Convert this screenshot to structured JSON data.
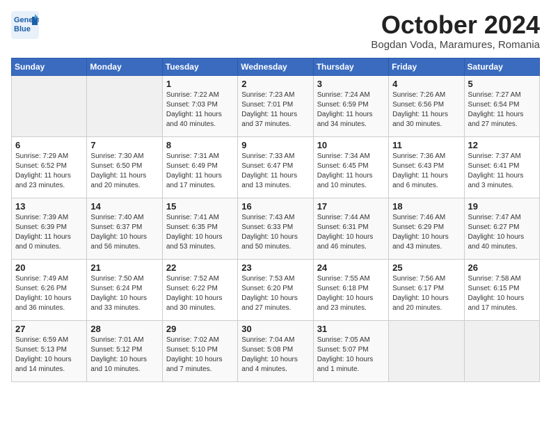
{
  "header": {
    "logo_line1": "General",
    "logo_line2": "Blue",
    "month": "October 2024",
    "location": "Bogdan Voda, Maramures, Romania"
  },
  "days_of_week": [
    "Sunday",
    "Monday",
    "Tuesday",
    "Wednesday",
    "Thursday",
    "Friday",
    "Saturday"
  ],
  "weeks": [
    [
      {
        "day": "",
        "info": ""
      },
      {
        "day": "",
        "info": ""
      },
      {
        "day": "1",
        "info": "Sunrise: 7:22 AM\nSunset: 7:03 PM\nDaylight: 11 hours and 40 minutes."
      },
      {
        "day": "2",
        "info": "Sunrise: 7:23 AM\nSunset: 7:01 PM\nDaylight: 11 hours and 37 minutes."
      },
      {
        "day": "3",
        "info": "Sunrise: 7:24 AM\nSunset: 6:59 PM\nDaylight: 11 hours and 34 minutes."
      },
      {
        "day": "4",
        "info": "Sunrise: 7:26 AM\nSunset: 6:56 PM\nDaylight: 11 hours and 30 minutes."
      },
      {
        "day": "5",
        "info": "Sunrise: 7:27 AM\nSunset: 6:54 PM\nDaylight: 11 hours and 27 minutes."
      }
    ],
    [
      {
        "day": "6",
        "info": "Sunrise: 7:29 AM\nSunset: 6:52 PM\nDaylight: 11 hours and 23 minutes."
      },
      {
        "day": "7",
        "info": "Sunrise: 7:30 AM\nSunset: 6:50 PM\nDaylight: 11 hours and 20 minutes."
      },
      {
        "day": "8",
        "info": "Sunrise: 7:31 AM\nSunset: 6:49 PM\nDaylight: 11 hours and 17 minutes."
      },
      {
        "day": "9",
        "info": "Sunrise: 7:33 AM\nSunset: 6:47 PM\nDaylight: 11 hours and 13 minutes."
      },
      {
        "day": "10",
        "info": "Sunrise: 7:34 AM\nSunset: 6:45 PM\nDaylight: 11 hours and 10 minutes."
      },
      {
        "day": "11",
        "info": "Sunrise: 7:36 AM\nSunset: 6:43 PM\nDaylight: 11 hours and 6 minutes."
      },
      {
        "day": "12",
        "info": "Sunrise: 7:37 AM\nSunset: 6:41 PM\nDaylight: 11 hours and 3 minutes."
      }
    ],
    [
      {
        "day": "13",
        "info": "Sunrise: 7:39 AM\nSunset: 6:39 PM\nDaylight: 11 hours and 0 minutes."
      },
      {
        "day": "14",
        "info": "Sunrise: 7:40 AM\nSunset: 6:37 PM\nDaylight: 10 hours and 56 minutes."
      },
      {
        "day": "15",
        "info": "Sunrise: 7:41 AM\nSunset: 6:35 PM\nDaylight: 10 hours and 53 minutes."
      },
      {
        "day": "16",
        "info": "Sunrise: 7:43 AM\nSunset: 6:33 PM\nDaylight: 10 hours and 50 minutes."
      },
      {
        "day": "17",
        "info": "Sunrise: 7:44 AM\nSunset: 6:31 PM\nDaylight: 10 hours and 46 minutes."
      },
      {
        "day": "18",
        "info": "Sunrise: 7:46 AM\nSunset: 6:29 PM\nDaylight: 10 hours and 43 minutes."
      },
      {
        "day": "19",
        "info": "Sunrise: 7:47 AM\nSunset: 6:27 PM\nDaylight: 10 hours and 40 minutes."
      }
    ],
    [
      {
        "day": "20",
        "info": "Sunrise: 7:49 AM\nSunset: 6:26 PM\nDaylight: 10 hours and 36 minutes."
      },
      {
        "day": "21",
        "info": "Sunrise: 7:50 AM\nSunset: 6:24 PM\nDaylight: 10 hours and 33 minutes."
      },
      {
        "day": "22",
        "info": "Sunrise: 7:52 AM\nSunset: 6:22 PM\nDaylight: 10 hours and 30 minutes."
      },
      {
        "day": "23",
        "info": "Sunrise: 7:53 AM\nSunset: 6:20 PM\nDaylight: 10 hours and 27 minutes."
      },
      {
        "day": "24",
        "info": "Sunrise: 7:55 AM\nSunset: 6:18 PM\nDaylight: 10 hours and 23 minutes."
      },
      {
        "day": "25",
        "info": "Sunrise: 7:56 AM\nSunset: 6:17 PM\nDaylight: 10 hours and 20 minutes."
      },
      {
        "day": "26",
        "info": "Sunrise: 7:58 AM\nSunset: 6:15 PM\nDaylight: 10 hours and 17 minutes."
      }
    ],
    [
      {
        "day": "27",
        "info": "Sunrise: 6:59 AM\nSunset: 5:13 PM\nDaylight: 10 hours and 14 minutes."
      },
      {
        "day": "28",
        "info": "Sunrise: 7:01 AM\nSunset: 5:12 PM\nDaylight: 10 hours and 10 minutes."
      },
      {
        "day": "29",
        "info": "Sunrise: 7:02 AM\nSunset: 5:10 PM\nDaylight: 10 hours and 7 minutes."
      },
      {
        "day": "30",
        "info": "Sunrise: 7:04 AM\nSunset: 5:08 PM\nDaylight: 10 hours and 4 minutes."
      },
      {
        "day": "31",
        "info": "Sunrise: 7:05 AM\nSunset: 5:07 PM\nDaylight: 10 hours and 1 minute."
      },
      {
        "day": "",
        "info": ""
      },
      {
        "day": "",
        "info": ""
      }
    ]
  ]
}
